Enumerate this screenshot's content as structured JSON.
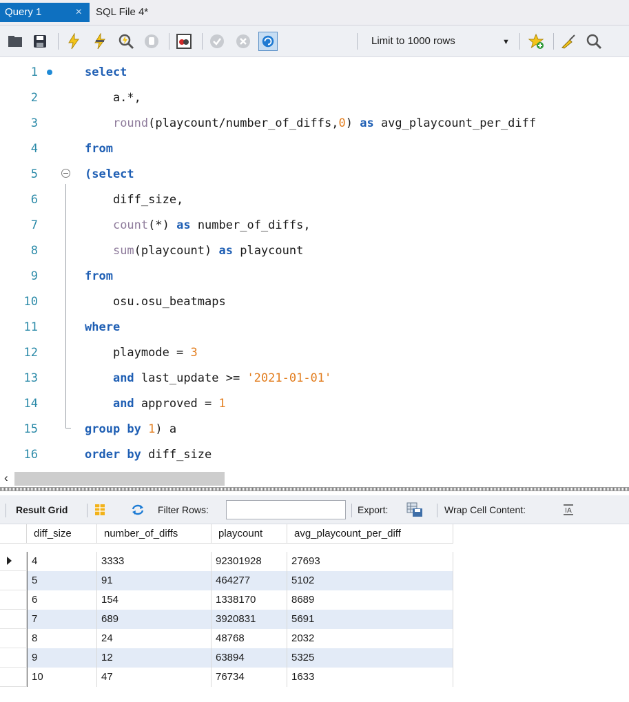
{
  "tabs": [
    {
      "label": "Query 1",
      "close": "×"
    },
    {
      "label": "SQL File 4*"
    }
  ],
  "toolbar": {
    "limit_select": "Limit to 1000 rows",
    "icons": [
      "open-folder-icon",
      "save-icon",
      "execute-icon",
      "execute-selection-icon",
      "explain-icon",
      "stop-icon",
      "toggle-output-icon",
      "commit-icon",
      "rollback-icon",
      "autocommit-icon",
      "add-snippet-icon",
      "beautify-icon",
      "find-icon"
    ]
  },
  "editor": {
    "lines": [
      {
        "n": "1"
      },
      {
        "n": "2"
      },
      {
        "n": "3"
      },
      {
        "n": "4"
      },
      {
        "n": "5"
      },
      {
        "n": "6"
      },
      {
        "n": "7"
      },
      {
        "n": "8"
      },
      {
        "n": "9"
      },
      {
        "n": "10"
      },
      {
        "n": "11"
      },
      {
        "n": "12"
      },
      {
        "n": "13"
      },
      {
        "n": "14"
      },
      {
        "n": "15"
      },
      {
        "n": "16"
      }
    ],
    "tokens": {
      "select": "select",
      "a_star": "    a.*,",
      "round": "round",
      "round_args_1": "(playcount/number_of_diffs,",
      "round_args_zero": "0",
      "round_args_2": ") ",
      "as": "as",
      "avg_alias": " avg_playcount_per_diff",
      "from": "from",
      "paren_select": "(select",
      "diff_size": "    diff_size,",
      "count": "count",
      "count_args": "(*) ",
      "num_diffs_alias": " number_of_diffs,",
      "sum": "sum",
      "sum_args": "(playcount) ",
      "playcount_alias": " playcount",
      "table": "    osu.osu_beatmaps",
      "where": "where",
      "playmode": "    playmode = ",
      "three": "3",
      "and": "and",
      "last_update": " last_update >= ",
      "date_str": "'2021-01-01'",
      "approved": " approved = ",
      "one": "1",
      "group_by": "group by",
      "group_tail": ") a",
      "order_by": "order by",
      "order_tail": " diff_size"
    }
  },
  "results": {
    "result_grid_label": "Result Grid",
    "filter_rows_label": "Filter Rows:",
    "filter_value": "",
    "export_label": "Export:",
    "wrap_label": "Wrap Cell Content:",
    "columns": [
      "diff_size",
      "number_of_diffs",
      "playcount",
      "avg_playcount_per_diff"
    ],
    "rows": [
      [
        "4",
        "3333",
        "92301928",
        "27693"
      ],
      [
        "5",
        "91",
        "464277",
        "5102"
      ],
      [
        "6",
        "154",
        "1338170",
        "8689"
      ],
      [
        "7",
        "689",
        "3920831",
        "5691"
      ],
      [
        "8",
        "24",
        "48768",
        "2032"
      ],
      [
        "9",
        "12",
        "63894",
        "5325"
      ],
      [
        "10",
        "47",
        "76734",
        "1633"
      ]
    ]
  }
}
